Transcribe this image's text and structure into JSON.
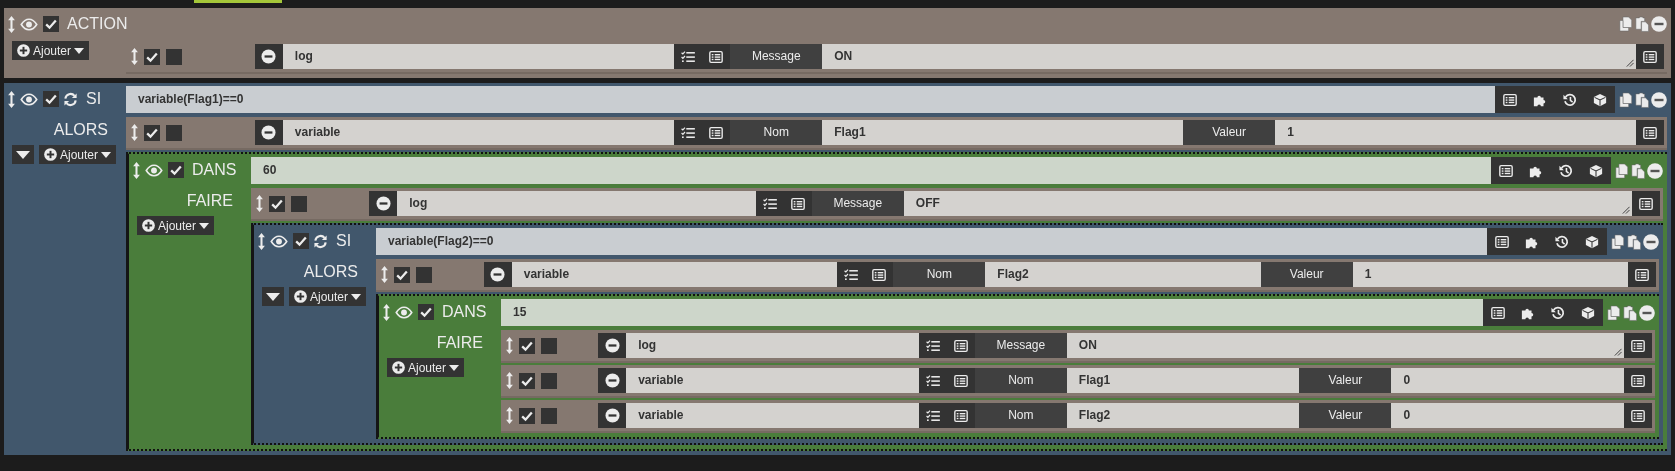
{
  "blocks": [
    {
      "kind": "action",
      "label": "ACTION",
      "enabled": true,
      "add_button": "Ajouter",
      "actions": [
        {
          "kind": "log",
          "enabled": true,
          "parallel": false,
          "command": "log",
          "param_label": "Message",
          "value": "ON"
        }
      ]
    },
    {
      "kind": "si",
      "label": "SI",
      "enabled": true,
      "condition": "variable(Flag1)==0",
      "then_label": "ALORS",
      "add_button": "Ajouter",
      "actions": [
        {
          "kind": "variable",
          "enabled": true,
          "parallel": false,
          "command": "variable",
          "name_label": "Nom",
          "name": "Flag1",
          "value_label": "Valeur",
          "value": "1"
        },
        {
          "kind": "dans",
          "label": "DANS",
          "enabled": true,
          "condition": "60",
          "then_label": "FAIRE",
          "add_button": "Ajouter",
          "actions": [
            {
              "kind": "log",
              "enabled": true,
              "parallel": false,
              "command": "log",
              "param_label": "Message",
              "value": "OFF"
            },
            {
              "kind": "si",
              "label": "SI",
              "enabled": true,
              "condition": "variable(Flag2)==0",
              "then_label": "ALORS",
              "add_button": "Ajouter",
              "actions": [
                {
                  "kind": "variable",
                  "enabled": true,
                  "parallel": false,
                  "command": "variable",
                  "name_label": "Nom",
                  "name": "Flag2",
                  "value_label": "Valeur",
                  "value": "1"
                },
                {
                  "kind": "dans",
                  "label": "DANS",
                  "enabled": true,
                  "condition": "15",
                  "then_label": "FAIRE",
                  "add_button": "Ajouter",
                  "actions": [
                    {
                      "kind": "log",
                      "enabled": true,
                      "parallel": false,
                      "command": "log",
                      "param_label": "Message",
                      "value": "ON"
                    },
                    {
                      "kind": "variable",
                      "enabled": true,
                      "parallel": false,
                      "command": "variable",
                      "name_label": "Nom",
                      "name": "Flag1",
                      "value_label": "Valeur",
                      "value": "0"
                    },
                    {
                      "kind": "variable",
                      "enabled": true,
                      "parallel": false,
                      "command": "variable",
                      "name_label": "Nom",
                      "name": "Flag2",
                      "value_label": "Valeur",
                      "value": "0"
                    }
                  ]
                }
              ]
            }
          ]
        }
      ]
    }
  ]
}
